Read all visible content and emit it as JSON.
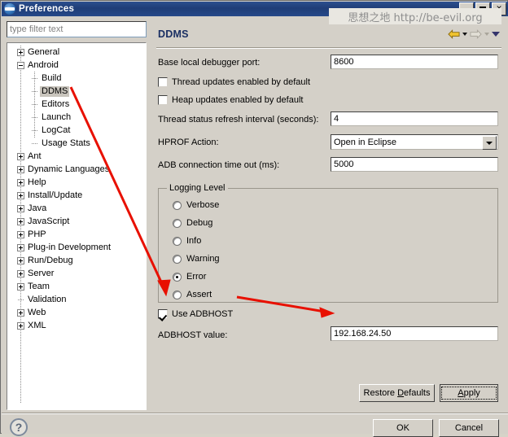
{
  "window": {
    "title": "Preferences",
    "icon": "eclipse-icon",
    "controls": {
      "minimize": "_",
      "maximize": "▢",
      "close": "✕"
    }
  },
  "watermark": {
    "text": "思想之地 http://be-evil.org"
  },
  "sidebar": {
    "filter_placeholder": "type filter text",
    "filter_value": "",
    "items": [
      {
        "label": "General",
        "level": 0,
        "toggle": "plus",
        "selected": false
      },
      {
        "label": "Android",
        "level": 0,
        "toggle": "minus",
        "selected": false
      },
      {
        "label": "Build",
        "level": 1,
        "toggle": "none",
        "selected": false
      },
      {
        "label": "DDMS",
        "level": 1,
        "toggle": "none",
        "selected": true
      },
      {
        "label": "Editors",
        "level": 1,
        "toggle": "none",
        "selected": false
      },
      {
        "label": "Launch",
        "level": 1,
        "toggle": "none",
        "selected": false
      },
      {
        "label": "LogCat",
        "level": 1,
        "toggle": "none",
        "selected": false
      },
      {
        "label": "Usage Stats",
        "level": 1,
        "toggle": "none",
        "selected": false
      },
      {
        "label": "Ant",
        "level": 0,
        "toggle": "plus",
        "selected": false
      },
      {
        "label": "Dynamic Languages",
        "level": 0,
        "toggle": "plus",
        "selected": false
      },
      {
        "label": "Help",
        "level": 0,
        "toggle": "plus",
        "selected": false
      },
      {
        "label": "Install/Update",
        "level": 0,
        "toggle": "plus",
        "selected": false
      },
      {
        "label": "Java",
        "level": 0,
        "toggle": "plus",
        "selected": false
      },
      {
        "label": "JavaScript",
        "level": 0,
        "toggle": "plus",
        "selected": false
      },
      {
        "label": "PHP",
        "level": 0,
        "toggle": "plus",
        "selected": false
      },
      {
        "label": "Plug-in Development",
        "level": 0,
        "toggle": "plus",
        "selected": false
      },
      {
        "label": "Run/Debug",
        "level": 0,
        "toggle": "plus",
        "selected": false
      },
      {
        "label": "Server",
        "level": 0,
        "toggle": "plus",
        "selected": false
      },
      {
        "label": "Team",
        "level": 0,
        "toggle": "plus",
        "selected": false
      },
      {
        "label": "Validation",
        "level": 0,
        "toggle": "none",
        "selected": false
      },
      {
        "label": "Web",
        "level": 0,
        "toggle": "plus",
        "selected": false
      },
      {
        "label": "XML",
        "level": 0,
        "toggle": "plus",
        "selected": false
      }
    ]
  },
  "page": {
    "title": "DDMS",
    "nav": {
      "back_icon": "back-arrow-icon",
      "back_menu_icon": "chevron-down-icon",
      "forward_icon": "forward-arrow-icon",
      "forward_menu_icon": "chevron-down-icon",
      "view_menu_icon": "chevron-down-icon"
    },
    "fields": {
      "base_port_label": "Base local debugger port:",
      "base_port_value": "8600",
      "thread_updates_label": "Thread updates enabled by default",
      "thread_updates_checked": false,
      "heap_updates_label": "Heap updates enabled by default",
      "heap_updates_checked": false,
      "refresh_interval_label": "Thread status refresh interval (seconds):",
      "refresh_interval_value": "4",
      "hprof_label": "HPROF Action:",
      "hprof_value": "Open in Eclipse",
      "adb_timeout_label": "ADB connection time out (ms):",
      "adb_timeout_value": "5000"
    },
    "logging": {
      "group_label": "Logging Level",
      "selected": "Error",
      "options": [
        "Verbose",
        "Debug",
        "Info",
        "Warning",
        "Error",
        "Assert"
      ]
    },
    "adbhost": {
      "use_label": "Use ADBHOST",
      "use_checked": true,
      "value_label": "ADBHOST value:",
      "value": "192.168.24.50"
    },
    "buttons": {
      "restore_defaults": "Restore Defaults",
      "restore_defaults_mnemonic": "D",
      "apply": "Apply",
      "apply_mnemonic": "A"
    }
  },
  "footer": {
    "help_icon": "question-mark-icon",
    "ok": "OK",
    "cancel": "Cancel"
  },
  "annotations": {
    "color": "#e81000",
    "arrow1": "ddms-to-use-adbhost",
    "arrow2": "use-adbhost-to-value-field"
  }
}
